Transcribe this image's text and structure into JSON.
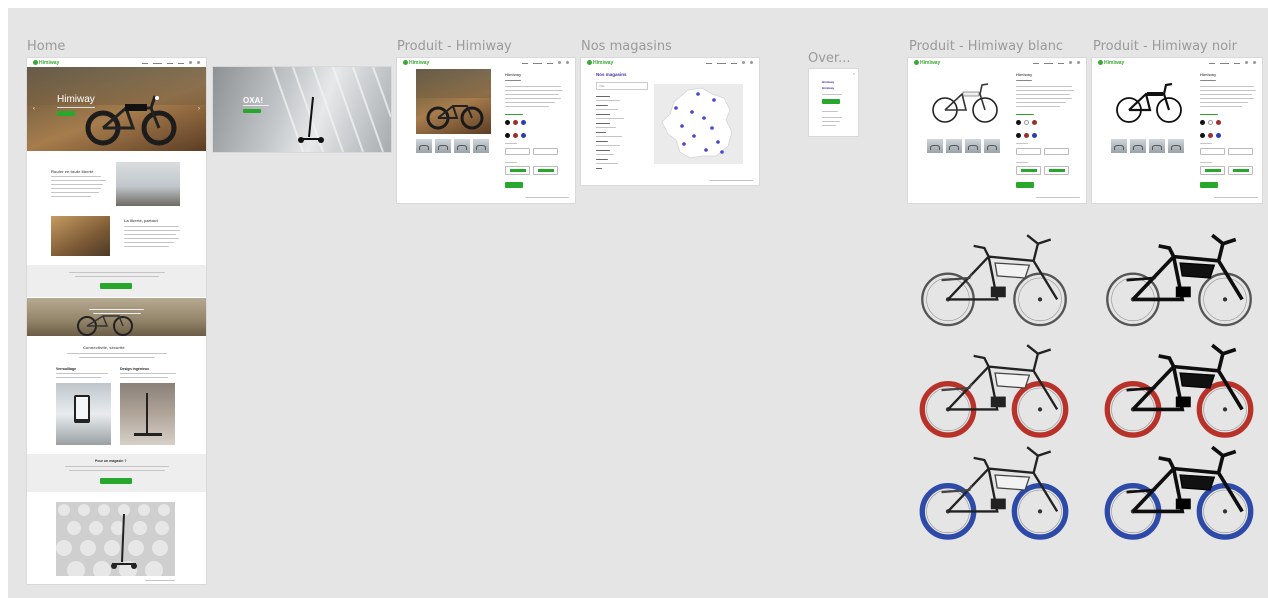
{
  "frames": {
    "home": {
      "label": "Home",
      "hero_title": "Himiway",
      "section1_title": "Rouler en toute liberté",
      "section2_title": "La liberté, partout",
      "section3_title": "Connectivité, sécurité",
      "feature1_title": "Verrouillage",
      "feature2_title": "Design ingénieux",
      "contact_title": "Pour un magasin ?"
    },
    "oxa": {
      "title": "OXA!"
    },
    "produit": {
      "label": "Produit - Himiway",
      "product_name": "Himiway"
    },
    "magasins": {
      "label": "Nos magasins",
      "title": "Nos magasins",
      "search_placeholder": "Ville"
    },
    "overlay": {
      "label": "Over...",
      "logo": "Himiway",
      "title": "Himiway"
    },
    "produit_blanc": {
      "label": "Produit - Himiway blanc",
      "product_name": "Himiway"
    },
    "produit_noir": {
      "label": "Produit - Himiway noir",
      "product_name": "Himiway"
    }
  },
  "brand": {
    "logo_text": "Himiway"
  },
  "colors": {
    "accent_green": "#27a82c",
    "pin_purple": "#4b44d2",
    "wheel_red": "#b8322a",
    "wheel_blue": "#2d4aa8",
    "canvas_bg": "#e5e5e5"
  },
  "swatches": [
    "#111111",
    "#9b2f2f",
    "#2a3fb0"
  ],
  "wheel_variants": [
    "#555555",
    "#b8322a",
    "#2d4aa8"
  ]
}
